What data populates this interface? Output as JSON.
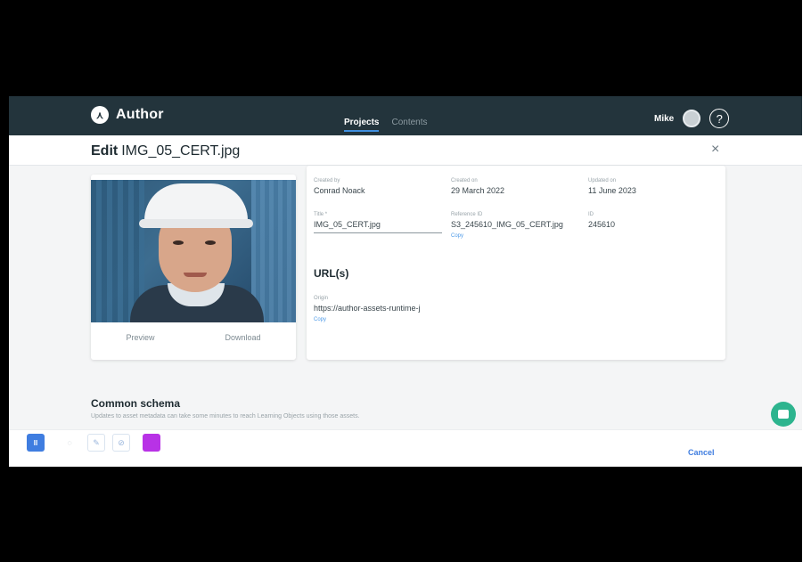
{
  "topbar": {
    "app_name": "Author",
    "tabs": [
      {
        "label": "Projects",
        "active": true
      },
      {
        "label": "Contents",
        "active": false
      }
    ],
    "user_name": "Mike",
    "help_label": "?"
  },
  "modal": {
    "edit_label": "Edit",
    "file_name": "IMG_05_CERT.jpg",
    "close_label": "×"
  },
  "image_card": {
    "preview_label": "Preview",
    "download_label": "Download"
  },
  "details": {
    "created_by": {
      "label": "Created by",
      "value": "Conrad Noack"
    },
    "created_on": {
      "label": "Created on",
      "value": "29 March 2022"
    },
    "updated_on": {
      "label": "Updated on",
      "value": "11 June 2023"
    },
    "title": {
      "label": "Title *",
      "value": "IMG_05_CERT.jpg"
    },
    "reference_id": {
      "label": "Reference ID",
      "value": "S3_245610_IMG_05_CERT.jpg",
      "copy_label": "Copy"
    },
    "id": {
      "label": "ID",
      "value": "245610"
    },
    "url_heading": "URL(s)",
    "origin": {
      "label": "Origin",
      "value": "https://author-assets-runtime-j",
      "copy_label": "Copy"
    }
  },
  "schema": {
    "title": "Common schema",
    "description": "Updates to asset metadata can take some minutes to reach Learning Objects using those assets."
  },
  "bottom_bar": {
    "pause_label": "II",
    "cancel_label": "Cancel",
    "swatch_color": "#b832e6"
  },
  "colors": {
    "topbar_bg": "#23343c",
    "accent": "#3f7de0",
    "chat_button": "#2db48e"
  }
}
